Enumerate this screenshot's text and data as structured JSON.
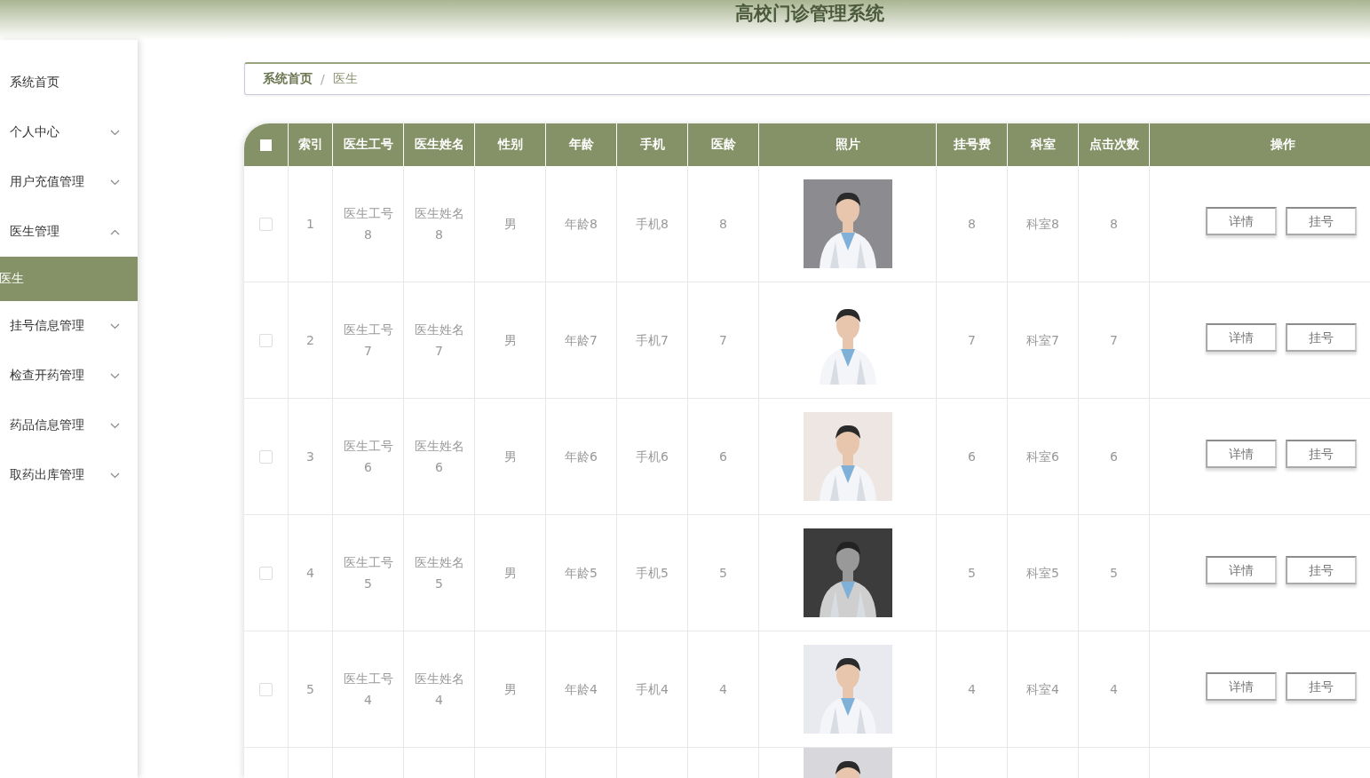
{
  "header": {
    "title": "高校门诊管理系统"
  },
  "sidebar": {
    "items": [
      {
        "label": "系统首页"
      },
      {
        "label": "个人中心",
        "expanded": false
      },
      {
        "label": "用户充值管理",
        "expanded": false
      },
      {
        "label": "医生管理",
        "expanded": true,
        "children": [
          {
            "label": "医生",
            "selected": true
          }
        ]
      },
      {
        "label": "挂号信息管理",
        "expanded": false
      },
      {
        "label": "检查开药管理",
        "expanded": false
      },
      {
        "label": "药品信息管理",
        "expanded": false
      },
      {
        "label": "取药出库管理",
        "expanded": false
      }
    ]
  },
  "breadcrumb": {
    "items": [
      "系统首页",
      "医生"
    ],
    "separator": "/"
  },
  "table": {
    "select_all_checked": false,
    "columns": [
      "索引",
      "医生工号",
      "医生姓名",
      "性别",
      "年龄",
      "手机",
      "医龄",
      "照片",
      "挂号费",
      "科室",
      "点击次数",
      "操作"
    ],
    "rows": [
      {
        "selected": false,
        "cells": [
          "1",
          "医生工号8",
          "医生姓名8",
          "男",
          "年龄8",
          "手机8",
          "8"
        ],
        "photo": {
          "kind": "picture"
        },
        "cells2": [
          "8",
          "科室8",
          "8"
        ],
        "actions": [
          "详情",
          "挂号"
        ]
      },
      {
        "selected": false,
        "cells": [
          "2",
          "医生工号7",
          "医生姓名7",
          "男",
          "年龄7",
          "手机7",
          "7"
        ],
        "photo": {
          "kind": "picture"
        },
        "cells2": [
          "7",
          "科室7",
          "7"
        ],
        "actions": [
          "详情",
          "挂号"
        ]
      },
      {
        "selected": false,
        "cells": [
          "3",
          "医生工号6",
          "医生姓名6",
          "男",
          "年龄6",
          "手机6",
          "6"
        ],
        "photo": {
          "kind": "picture"
        },
        "cells2": [
          "6",
          "科室6",
          "6"
        ],
        "actions": [
          "详情",
          "挂号"
        ]
      },
      {
        "selected": false,
        "cells": [
          "4",
          "医生工号5",
          "医生姓名5",
          "男",
          "年龄5",
          "手机5",
          "5"
        ],
        "photo": {
          "kind": "picture"
        },
        "cells2": [
          "5",
          "科室5",
          "5"
        ],
        "actions": [
          "详情",
          "挂号"
        ]
      },
      {
        "selected": false,
        "cells": [
          "5",
          "医生工号4",
          "医生姓名4",
          "男",
          "年龄4",
          "手机4",
          "4"
        ],
        "photo": {
          "kind": "picture"
        },
        "cells2": [
          "4",
          "科室4",
          "4"
        ],
        "actions": [
          "详情",
          "挂号"
        ]
      }
    ],
    "cut_off_row": {
      "photo": {
        "kind": "picture"
      }
    }
  }
}
